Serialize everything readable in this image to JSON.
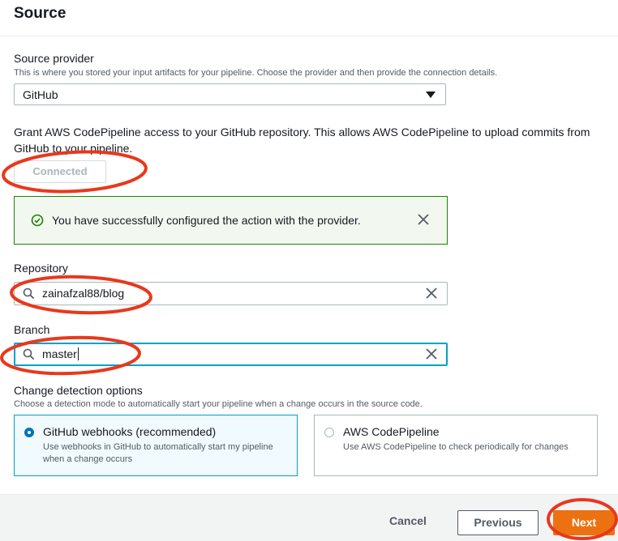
{
  "section": {
    "title": "Source"
  },
  "source_provider": {
    "label": "Source provider",
    "description": "This is where you stored your input artifacts for your pipeline. Choose the provider and then provide the connection details.",
    "selected": "GitHub"
  },
  "github": {
    "grant_text": "Grant AWS CodePipeline access to your GitHub repository. This allows AWS CodePipeline to upload commits from GitHub to your pipeline.",
    "connect_button": "Connected"
  },
  "alert": {
    "message": "You have successfully configured the action with the provider.",
    "color": "#1d8102"
  },
  "repository": {
    "label": "Repository",
    "value": "zainafzal88/blog"
  },
  "branch": {
    "label": "Branch",
    "value": "master"
  },
  "change_detection": {
    "label": "Change detection options",
    "description": "Choose a detection mode to automatically start your pipeline when a change occurs in the source code.",
    "options": [
      {
        "title": "GitHub webhooks (recommended)",
        "description": "Use webhooks in GitHub to automatically start my pipeline when a change occurs",
        "selected": true
      },
      {
        "title": "AWS CodePipeline",
        "description": "Use AWS CodePipeline to check periodically for changes",
        "selected": false
      }
    ]
  },
  "footer": {
    "cancel": "Cancel",
    "previous": "Previous",
    "next": "Next"
  },
  "colors": {
    "accent": "#ec7211",
    "focus": "#00a1c9",
    "annotation": "#e8381c"
  },
  "icons": {
    "check": "check-circle-icon",
    "close": "close-icon",
    "search": "search-icon",
    "clear": "clear-icon",
    "dropdown": "caret-down-icon"
  }
}
